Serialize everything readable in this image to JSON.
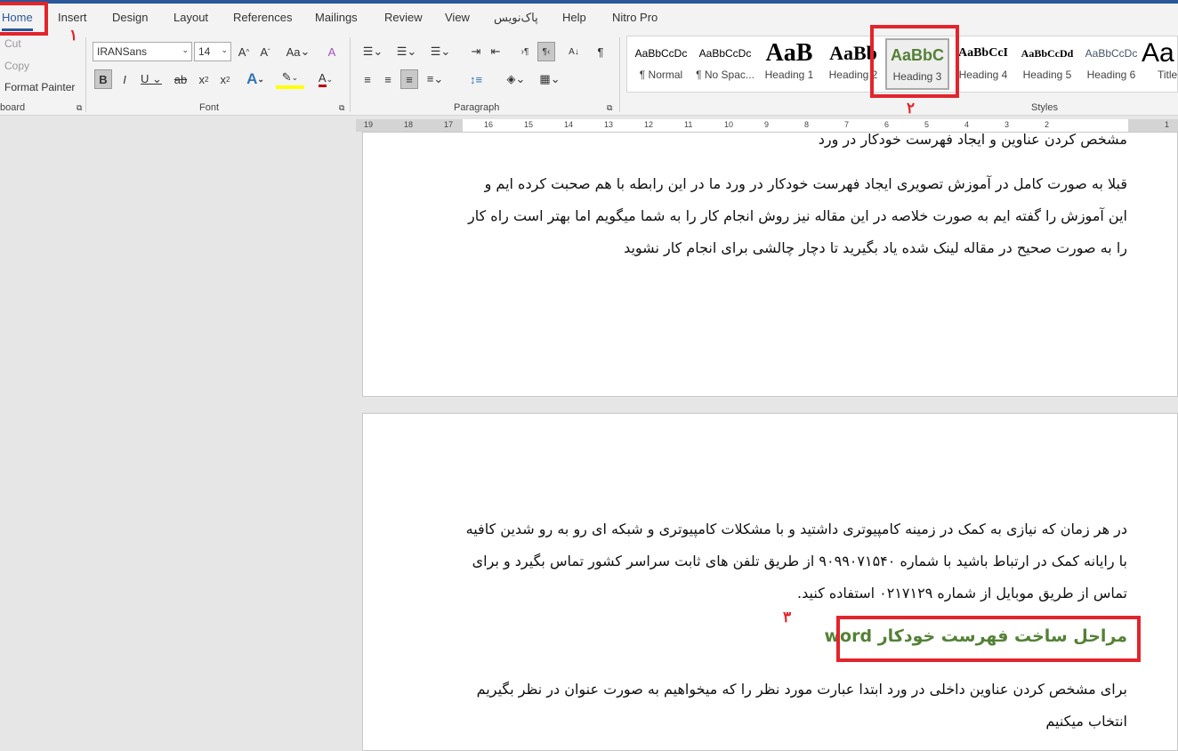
{
  "tabs": [
    "Home",
    "Insert",
    "Design",
    "Layout",
    "References",
    "Mailings",
    "Review",
    "View",
    "پاک‌نویس",
    "Help",
    "Nitro Pro"
  ],
  "clipboard": {
    "cut": "Cut",
    "copy": "Copy",
    "format_painter": "Format Painter",
    "label": "board"
  },
  "font": {
    "name": "IRANSans",
    "size": "14",
    "label": "Font",
    "change_case": "Aa"
  },
  "paragraph": {
    "label": "Paragraph"
  },
  "styles": {
    "label": "Styles",
    "items": [
      {
        "preview": "AaBbCcDc",
        "name": "¶ Normal"
      },
      {
        "preview": "AaBbCcDc",
        "name": "¶ No Spac..."
      },
      {
        "preview": "AaB",
        "name": "Heading 1"
      },
      {
        "preview": "AaBb",
        "name": "Heading 2"
      },
      {
        "preview": "AaBbC",
        "name": "Heading 3"
      },
      {
        "preview": "AaBbCcI",
        "name": "Heading 4"
      },
      {
        "preview": "AaBbCcDd",
        "name": "Heading 5"
      },
      {
        "preview": "AaBbCcDc",
        "name": "Heading 6"
      },
      {
        "preview": "Aa",
        "name": "Title"
      }
    ],
    "selected": "Heading 3"
  },
  "ruler": [
    "19",
    "18",
    "17",
    "16",
    "15",
    "14",
    "13",
    "12",
    "11",
    "10",
    "9",
    "8",
    "7",
    "6",
    "5",
    "4",
    "3",
    "2",
    "1"
  ],
  "annotations": {
    "one": "۱",
    "two": "۲",
    "three": "۳"
  },
  "document": {
    "page1_heading_line": "مشخص کردن عناوین و ایجاد فهرست خودکار در ورد",
    "page1_para": "قبلا به صورت کامل در آموزش تصویری ایجاد فهرست خودکار در ورد ما در این رابطه با هم صحبت کرده ایم و این آموزش را گفته ایم به صورت خلاصه در این مقاله نیز روش انجام کار را به شما میگویم اما بهتر است راه کار را به صورت صحیح در مقاله لینک شده یاد بگیرید تا دچار چالشی برای انجام کار نشوید",
    "page2_para": "در هر زمان که نیازی به کمک در زمینه کامپیوتری داشتید و با مشکلات کامپیوتری و شبکه ای رو به رو شدین کافیه با رایانه کمک در ارتباط باشید با شماره ۹۰۹۹۰۷۱۵۴۰ از طریق تلفن های ثابت سراسر کشور تماس بگیرد و برای تماس از طریق موبایل از شماره ۰۲۱۷۱۲۹ استفاده کنید.",
    "heading3": "مراحل ساخت فهرست خودکار word",
    "page2_para2": "برای مشخص کردن عناوین داخلی در ورد ابتدا عبارت مورد نظر را که میخواهیم به صورت عنوان در نظر بگیریم انتخاب میکنیم"
  },
  "colors": {
    "accent": "#2b579a",
    "annotation": "#e3242b",
    "heading3": "#538135"
  }
}
